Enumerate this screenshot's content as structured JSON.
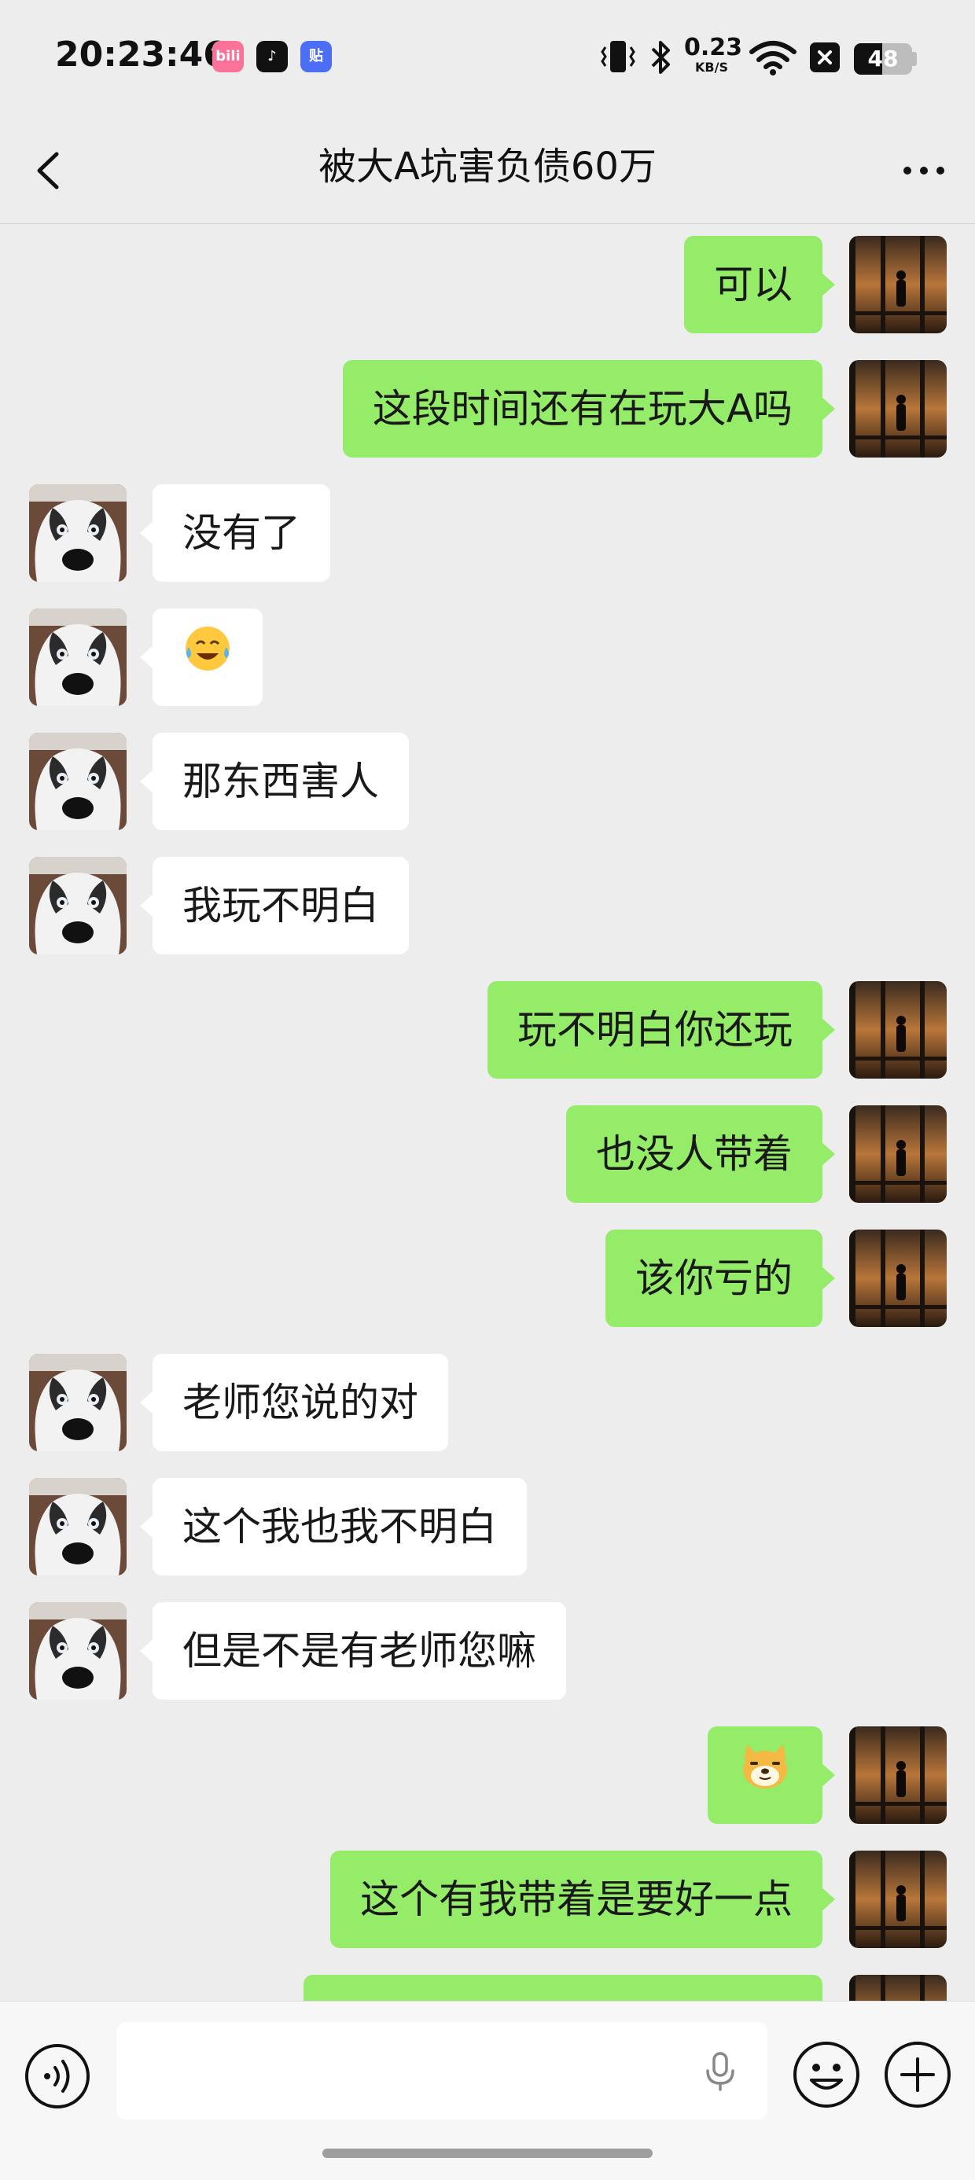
{
  "status_bar": {
    "time": "20:23:46",
    "apps": [
      {
        "icon": "bilibili-icon",
        "label": "bili",
        "color": "#FB7299"
      },
      {
        "icon": "tiktok-icon",
        "label": "♪",
        "color": "#111111"
      },
      {
        "icon": "tieba-icon",
        "label": "贴",
        "color": "#4C6EF5"
      }
    ],
    "net_speed_value": "0.23",
    "net_speed_unit": "KB/S",
    "battery_level": "48"
  },
  "nav": {
    "title": "被大A坑害负债60万"
  },
  "messages": [
    {
      "side": "me",
      "text": "可以",
      "emoji": null
    },
    {
      "side": "me",
      "text": "这段时间还有在玩大A吗",
      "emoji": null
    },
    {
      "side": "them",
      "text": "没有了",
      "emoji": null
    },
    {
      "side": "them",
      "text": "",
      "emoji": "tears-of-joy-face"
    },
    {
      "side": "them",
      "text": "那东西害人",
      "emoji": null
    },
    {
      "side": "them",
      "text": "我玩不明白",
      "emoji": null
    },
    {
      "side": "me",
      "text": "玩不明白你还玩",
      "emoji": null
    },
    {
      "side": "me",
      "text": "也没人带着",
      "emoji": null
    },
    {
      "side": "me",
      "text": "该你亏的",
      "emoji": null
    },
    {
      "side": "them",
      "text": "老师您说的对",
      "emoji": null
    },
    {
      "side": "them",
      "text": "这个我也我不明白",
      "emoji": null
    },
    {
      "side": "them",
      "text": "但是不是有老师您嘛",
      "emoji": null
    },
    {
      "side": "me",
      "text": "",
      "emoji": "doge-face"
    },
    {
      "side": "me",
      "text": "这个有我带着是要好一点",
      "emoji": null
    },
    {
      "side": "me",
      "text": "",
      "emoji": null
    }
  ],
  "input_bar": {
    "text_value": ""
  },
  "colors": {
    "background": "#EDEDED",
    "my_bubble": "#95EC69",
    "their_bubble": "#FFFFFF"
  }
}
